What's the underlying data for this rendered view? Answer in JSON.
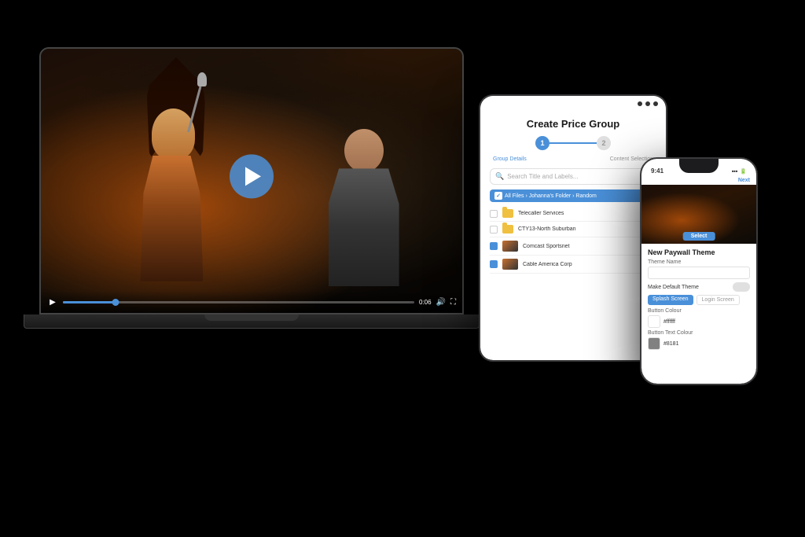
{
  "scene": {
    "bg_color": "#000000"
  },
  "laptop": {
    "video": {
      "play_button_label": "Play",
      "time_current": "0:06",
      "progress_percent": 15
    }
  },
  "tablet": {
    "title": "Create Price Group",
    "step1_label": "Group Details",
    "step2_label": "Content Selection",
    "step1_number": "1",
    "step2_number": "2",
    "search_placeholder": "Search Title and Labels...",
    "breadcrumb": "All Files › Johanna's Folder › Random",
    "files": [
      {
        "name": "Telecaller Services",
        "type": "folder",
        "checked": false
      },
      {
        "name": "CTY13-North Suburban",
        "type": "folder",
        "checked": false
      },
      {
        "name": "Comcast Sportsnet",
        "type": "video",
        "checked": true
      },
      {
        "name": "Cable America Corp",
        "type": "video",
        "checked": true
      }
    ]
  },
  "phone": {
    "header_button": "Next",
    "concert_button": "Select",
    "section_title": "New Paywall Theme",
    "theme_name_label": "Theme Name",
    "theme_name_value": "",
    "make_default_label": "Make Default Theme",
    "splash_screen_tab": "Splash Screen",
    "login_screen_tab": "Login Screen",
    "button_colour_label": "Button Colour",
    "button_colour_value": "#ffffff",
    "button_text_colour_label": "Button Text Colour",
    "button_text_colour_value": "#8181"
  }
}
